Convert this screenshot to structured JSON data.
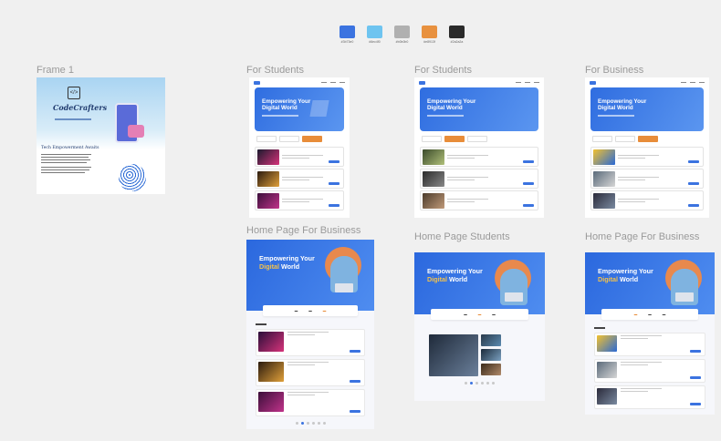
{
  "palette": [
    {
      "label": "#3b73e0",
      "color": "#3b73e0"
    },
    {
      "label": "#6ec4f0",
      "color": "#6ec4f0"
    },
    {
      "label": "#b0b0b0",
      "color": "#b0b0b0"
    },
    {
      "label": "#e8913f",
      "color": "#e8913f"
    },
    {
      "label": "#2a2a2a",
      "color": "#2a2a2a"
    }
  ],
  "frames": {
    "frame1": "Frame 1",
    "students1": "For Students",
    "students2": "For Students",
    "business1": "For Business",
    "homeBusiness": "Home Page For Business",
    "homeStudents": "Home Page Students",
    "homeBusiness2": "Home Page For Business"
  },
  "landing": {
    "brand": "CodeCrafters",
    "heading": "Tech Empowerment Awaits"
  },
  "hero": {
    "title": "Empowering Your Digital World",
    "title_a": "Empowering Your",
    "title_b": "Digital",
    "title_c": "World"
  }
}
